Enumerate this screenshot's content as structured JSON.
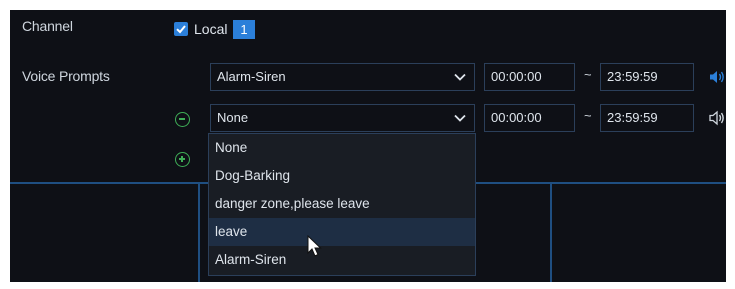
{
  "channel": {
    "label": "Channel",
    "local_label": "Local",
    "channel_number": "1",
    "local_checked": true
  },
  "voice_prompts": {
    "label": "Voice Prompts",
    "rows": [
      {
        "prompt": "Alarm-Siren",
        "start_time": "00:00:00",
        "separator": "~",
        "end_time": "23:59:59",
        "speaker_icon": "speaker-icon",
        "speaker_active": true
      },
      {
        "prompt": "None",
        "start_time": "00:00:00",
        "separator": "~",
        "end_time": "23:59:59",
        "speaker_icon": "speaker-icon",
        "speaker_active": false
      }
    ],
    "remove_icon": "minus-circle-icon",
    "add_icon": "plus-circle-icon"
  },
  "dropdown": {
    "options": [
      "None",
      "Dog-Barking",
      "danger zone,please leave",
      "leave",
      "Alarm-Siren"
    ],
    "hovered_option": "leave"
  },
  "colors": {
    "accent": "#2b7fd9",
    "background": "#0e1016",
    "add_remove": "#3fae57",
    "hover_row": "#1e2e44"
  }
}
